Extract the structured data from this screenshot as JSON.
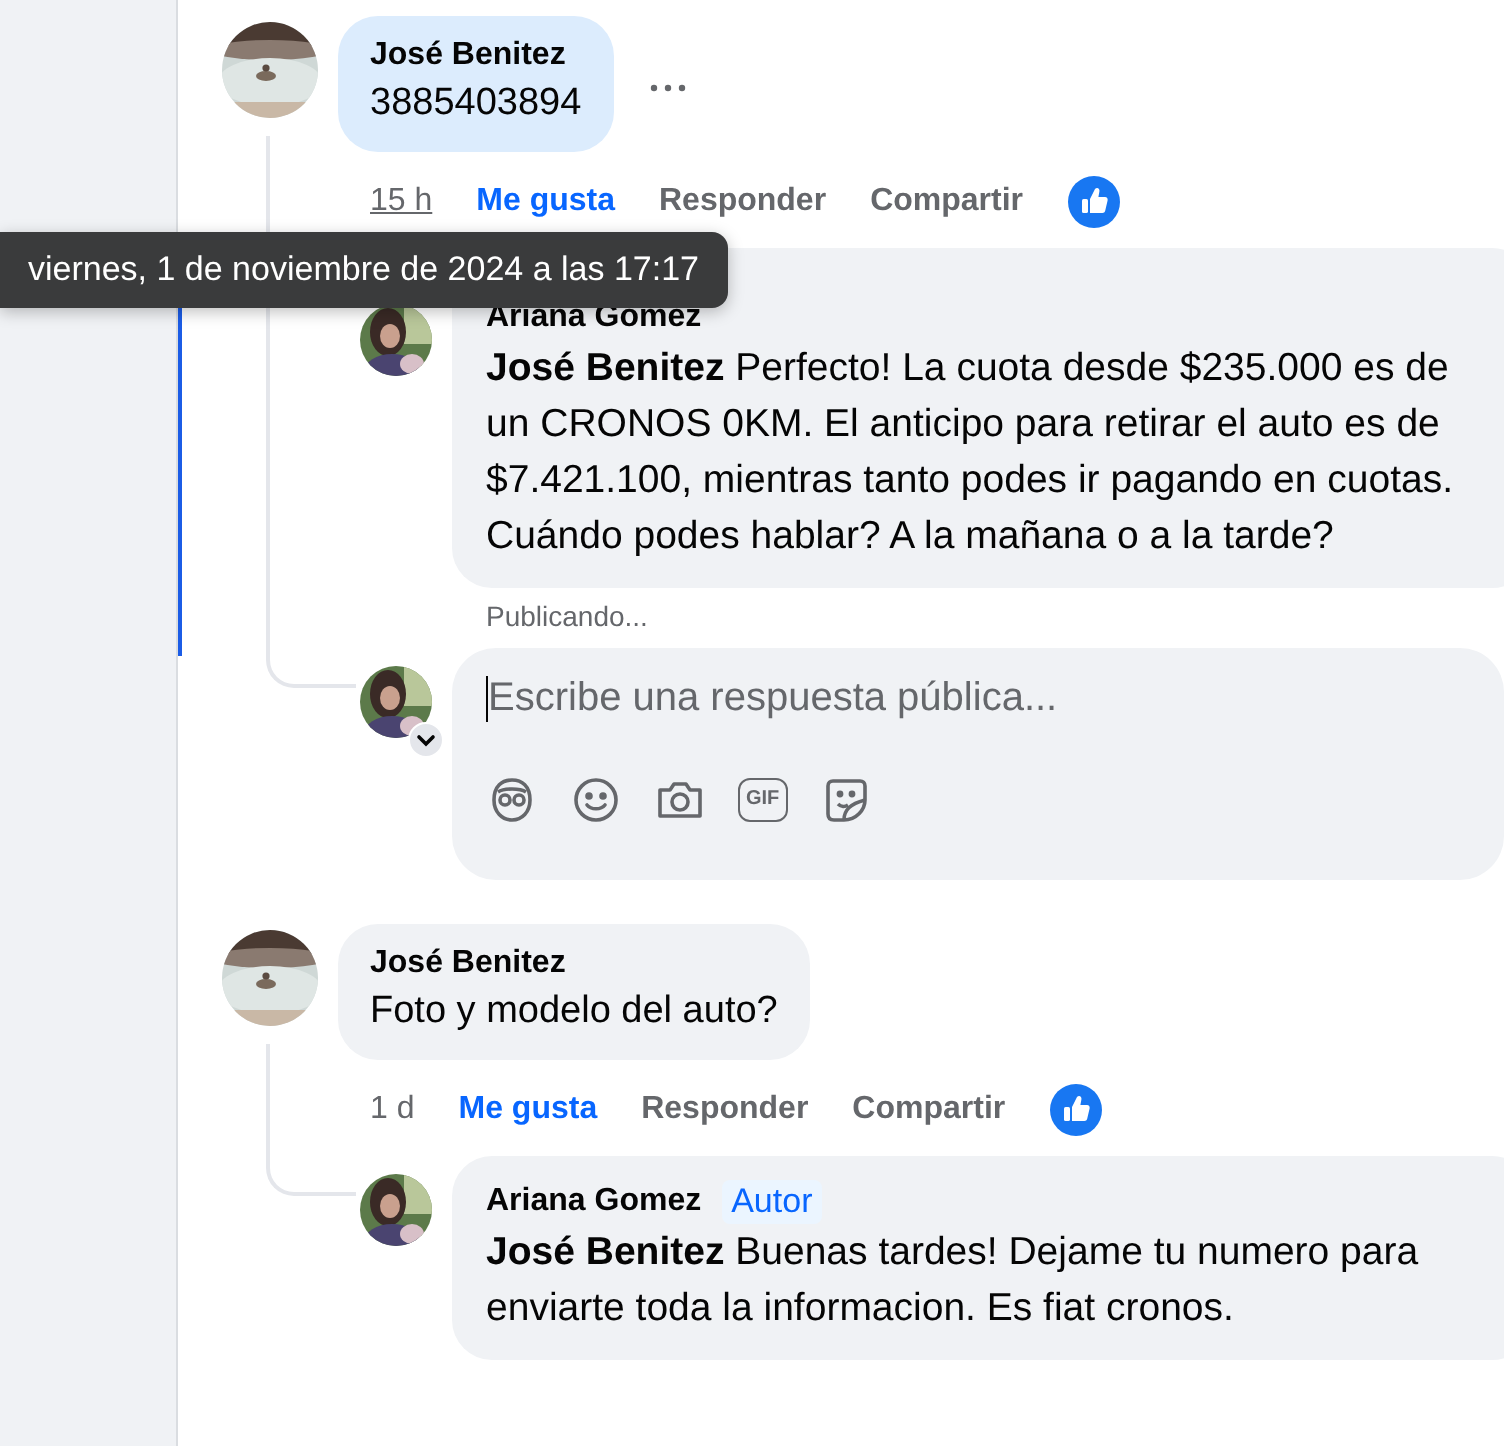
{
  "tooltip": "viernes, 1 de noviembre de 2024 a las 17:17",
  "comments": [
    {
      "author": "José Benitez",
      "text": "3885403894",
      "highlighted": true,
      "menu_visible": true,
      "time": "15 h",
      "time_hovered": true,
      "liked": true,
      "like_label": "Me gusta",
      "reply_label": "Responder",
      "share_label": "Compartir",
      "replies": [
        {
          "author": "Ariana Gomez",
          "text": "**José Benitez** Perfecto! La cuota desde $235.000 es de un CRONOS 0KM. El anticipo para retirar el auto es de $7.421.100, mientras tanto podes ir pagando en cuotas. Cuándo podes hablar? A la mañana o a la tarde?",
          "status": "Publicando...",
          "focused": true
        }
      ],
      "composer": {
        "placeholder": "Escribe una respuesta pública...",
        "tools": [
          {
            "kind": "avatar"
          },
          {
            "kind": "emoji"
          },
          {
            "kind": "camera"
          },
          {
            "kind": "gif",
            "label": "GIF"
          },
          {
            "kind": "sticker"
          }
        ]
      }
    },
    {
      "author": "José Benitez",
      "text": "Foto y modelo del auto?",
      "highlighted": false,
      "menu_visible": false,
      "time": "1 d",
      "time_hovered": false,
      "liked": true,
      "like_label": "Me gusta",
      "reply_label": "Responder",
      "share_label": "Compartir",
      "replies": [
        {
          "author": "Ariana Gomez",
          "badge": "Autor",
          "text": "**José Benitez** Buenas tardes! Dejame tu numero para enviarte toda la informacion. Es fiat cronos.",
          "focused": false
        }
      ]
    }
  ]
}
